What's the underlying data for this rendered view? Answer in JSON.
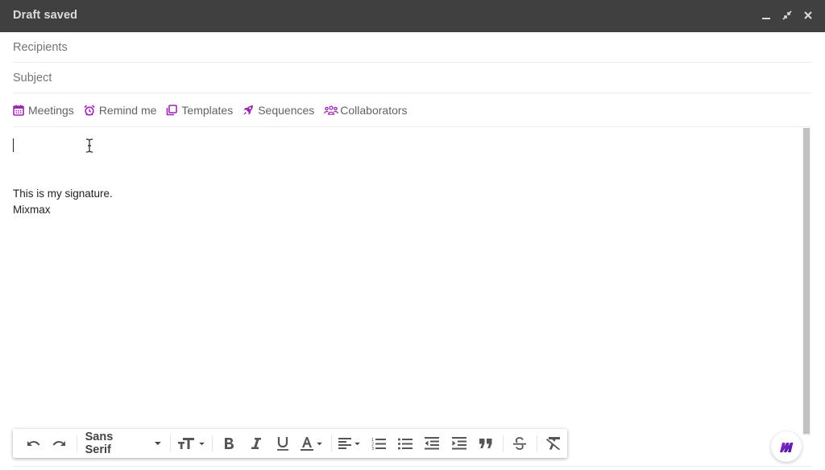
{
  "window": {
    "title": "Draft saved",
    "controls": {
      "minimize": "minimize-icon",
      "exit_fullscreen": "exit-fullscreen-icon",
      "close": "close-icon"
    }
  },
  "fields": {
    "recipients_placeholder": "Recipients",
    "subject_placeholder": "Subject"
  },
  "mixmax_toolbar": {
    "accent_color": "#9c27b0",
    "items": [
      {
        "label": "Meetings",
        "icon": "calendar-icon"
      },
      {
        "label": "Remind me",
        "icon": "alarm-clock-icon"
      },
      {
        "label": "Templates",
        "icon": "templates-icon"
      },
      {
        "label": "Sequences",
        "icon": "rocket-icon"
      },
      {
        "label": "Collaborators",
        "icon": "people-icon"
      }
    ]
  },
  "body": {
    "signature_lines": [
      "This is my signature.",
      "Mixmax"
    ]
  },
  "format_toolbar": {
    "font_family": "Sans Serif",
    "buttons": [
      "undo",
      "redo",
      "font-family",
      "font-size",
      "bold",
      "italic",
      "underline",
      "text-color",
      "align",
      "numbered-list",
      "bulleted-list",
      "indent-less",
      "indent-more",
      "quote",
      "strikethrough",
      "remove-formatting"
    ]
  },
  "mixmax_button": {
    "icon": "mixmax-logo-icon",
    "colors": [
      "#7b2ff7",
      "#4a148c"
    ]
  }
}
